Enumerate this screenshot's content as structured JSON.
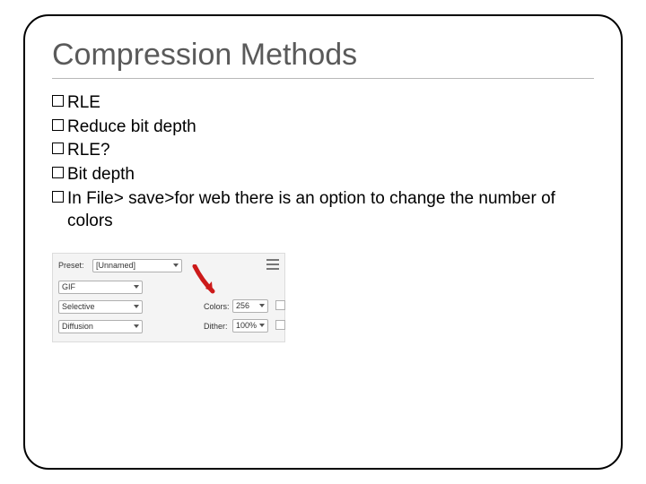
{
  "title": "Compression Methods",
  "bullets": [
    "RLE",
    "Reduce bit depth",
    "RLE?",
    "Bit depth",
    "In File> save>for web there is an option to change the number of colors"
  ],
  "mock": {
    "preset_label": "Preset:",
    "preset_value": "[Unnamed]",
    "format_value": "GIF",
    "reduction_value": "Selective",
    "dither_type": "Diffusion",
    "colors_label": "Colors:",
    "colors_value": "256",
    "dither_label": "Dither:",
    "dither_value": "100%"
  }
}
